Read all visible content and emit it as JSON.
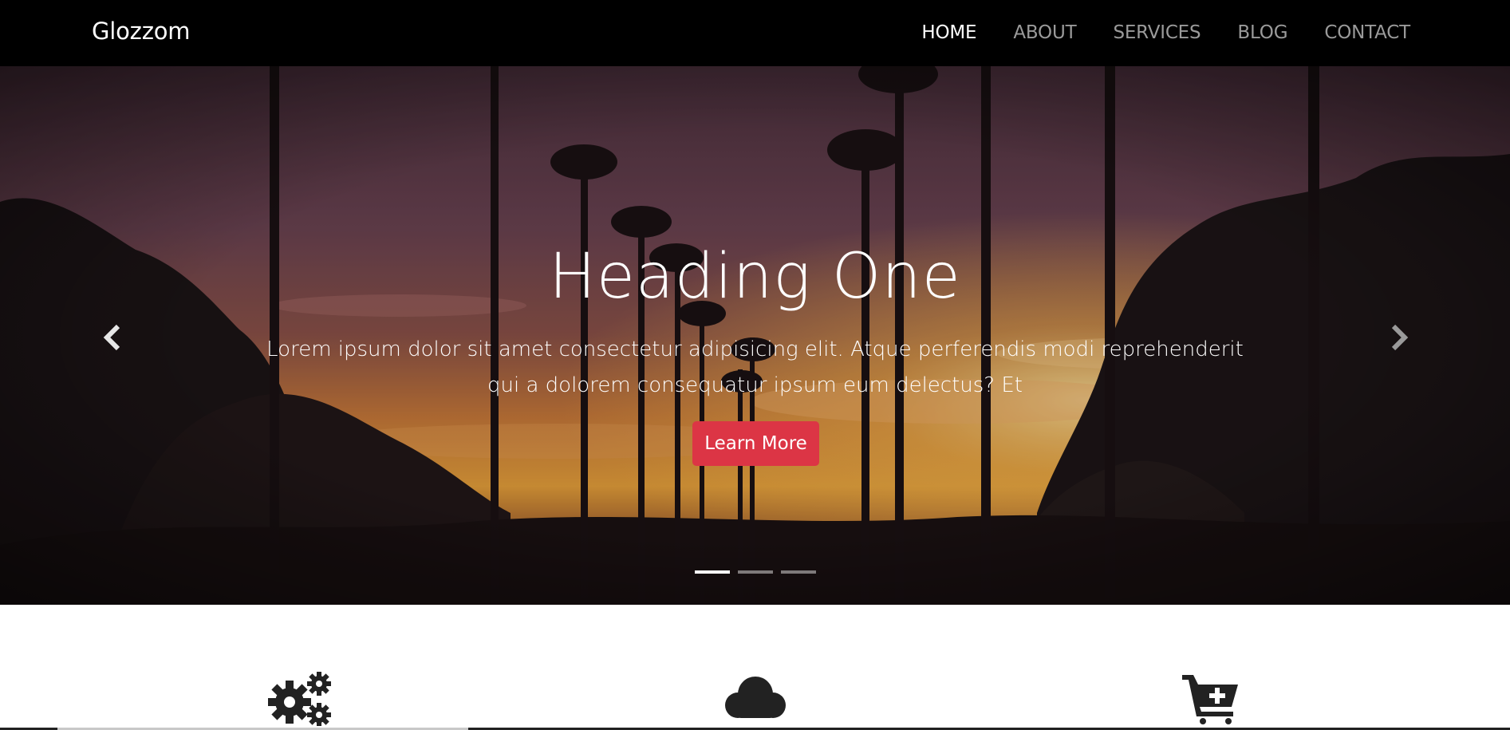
{
  "navbar": {
    "brand": "Glozzom",
    "links": [
      {
        "label": "HOME",
        "active": true
      },
      {
        "label": "ABOUT",
        "active": false
      },
      {
        "label": "SERVICES",
        "active": false
      },
      {
        "label": "BLOG",
        "active": false
      },
      {
        "label": "CONTACT",
        "active": false
      }
    ]
  },
  "hero": {
    "heading": "Heading One",
    "text": "Lorem ipsum dolor sit amet consectetur adipisicing elit. Atque perferendis modi reprehenderit qui a dolorem consequatur ipsum eum delectus? Et",
    "button_label": "Learn More",
    "prev_icon": "chevron-left-icon",
    "next_icon": "chevron-right-icon",
    "slide_count": 3,
    "active_slide": 1
  },
  "features": {
    "icons": [
      "gears-icon",
      "cloud-icon",
      "cart-plus-icon"
    ]
  },
  "colors": {
    "nav_bg": "#000000",
    "accent": "#dc3545",
    "nav_link": "#9a9a9a",
    "icon": "#222222"
  }
}
